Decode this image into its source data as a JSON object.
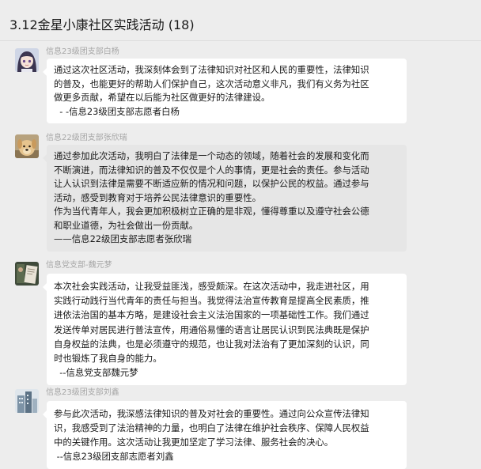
{
  "header": {
    "title": "3.12金星小康社区实践活动 (18)"
  },
  "messages": [
    {
      "sender": "信息23级团支部白杨",
      "avatar": "anime-girl-avatar",
      "lines": [
        "通过这次社区活动，我深刻体会到了法律知识对社区和人民的重要性，法律知识",
        "的普及，也能更好的帮助人们保护自己，这次活动意义非凡，我们有义务为社区",
        "做更多贡献，希望在以后能为社区做更好的法律建设。",
        "  - -信息23级团支部志愿者白杨"
      ]
    },
    {
      "sender": "信息22级团支部张欣瑞",
      "avatar": "dog-avatar",
      "lines": [
        "通过参加此次活动，我明白了法律是一个动态的领域，随着社会的发展和变化而",
        "不断演进，而法律知识的普及不仅仅是个人的事情，更是社会的责任。参与活动",
        "让人认识到法律是需要不断适应新的情况和问题，以保护公民的权益。通过参与",
        "活动，感受到教育对于培养公民法律意识的重要性。",
        "作为当代青年人，我会更加积极树立正确的是非观，懂得尊重以及遵守社会公德",
        "和职业道德，为社会做出一份贡献。",
        "——信息22级团支部志愿者张欣瑞"
      ]
    },
    {
      "sender": "信息党支部-魏元梦",
      "avatar": "photo-avatar",
      "lines": [
        "本次社会实践活动，让我受益匪浅，感受颇深。在这次活动中，我走进社区，用",
        "实践行动践行当代青年的责任与担当。我觉得法治宣传教育是提高全民素质，推",
        "进依法治国的基本方略，是建设社会主义法治国家的一项基础性工作。我们通过",
        "发送传单对居民进行普法宣传，用通俗易懂的语言让居民认识到民法典既是保护",
        "自身权益的法典，也是必须遵守的规范，也让我对法治有了更加深刻的认识，同",
        "时也锻炼了我自身的能力。",
        "  --信息党支部魏元梦"
      ]
    },
    {
      "sender": "信息23级团支部刘鑫",
      "avatar": "building-avatar",
      "lines": [
        "参与此次活动，我深感法律知识的普及对社会的重要性。通过向公众宣传法律知",
        "识，我感受到了法治精神的力量，也明白了法律在维护社会秩序、保障人民权益",
        "中的关键作用。这次活动让我更加坚定了学习法律、服务社会的决心。",
        " --信息23级团支部志愿者刘鑫"
      ]
    }
  ]
}
